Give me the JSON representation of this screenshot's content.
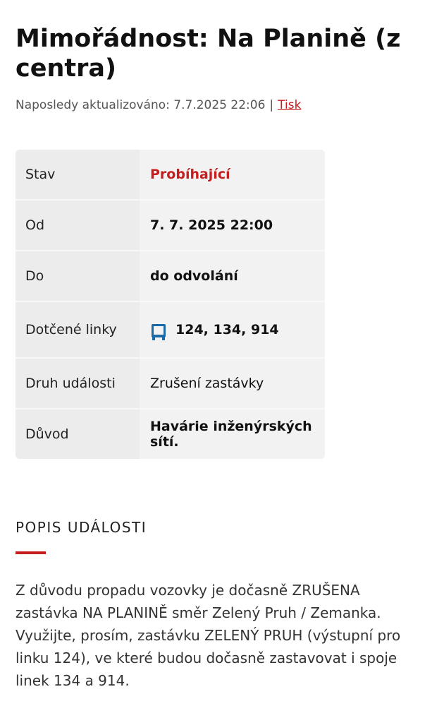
{
  "page": {
    "title": "Mimořádnost: Na Planině (z centra)",
    "updated_label": "Naposledy aktualizováno: 7.7.2025 22:06",
    "separator": "|",
    "print_link": "Tisk"
  },
  "info_table": {
    "rows": [
      {
        "label": "Stav",
        "value": "Probíhající",
        "status_color": "#c41e1e"
      },
      {
        "label": "Od",
        "value": "7. 7. 2025 22:00"
      },
      {
        "label": "Do",
        "value": "do odvolání"
      },
      {
        "label": "Dotčené linky",
        "value": "124, 134, 914",
        "icon": "bus-icon"
      },
      {
        "label": "Druh události",
        "value": "Zrušení zastávky"
      },
      {
        "label": "Důvod",
        "value": "Havárie inženýrských sítí."
      }
    ]
  },
  "description": {
    "heading": "POPIS UDÁLOSTI",
    "text": "Z důvodu propadu vozovky je dočasně ZRUŠENA zastávka NA PLANINĚ směr Zelený Pruh / Zemanka. Využijte, prosím, zastávku ZELENÝ PRUH (výstupní pro linku 124), ve které budou dočasně zastavovat i spoje linek 134 a 914."
  },
  "colors": {
    "accent": "#c41e1e",
    "bus_icon": "#1a6aa8"
  }
}
